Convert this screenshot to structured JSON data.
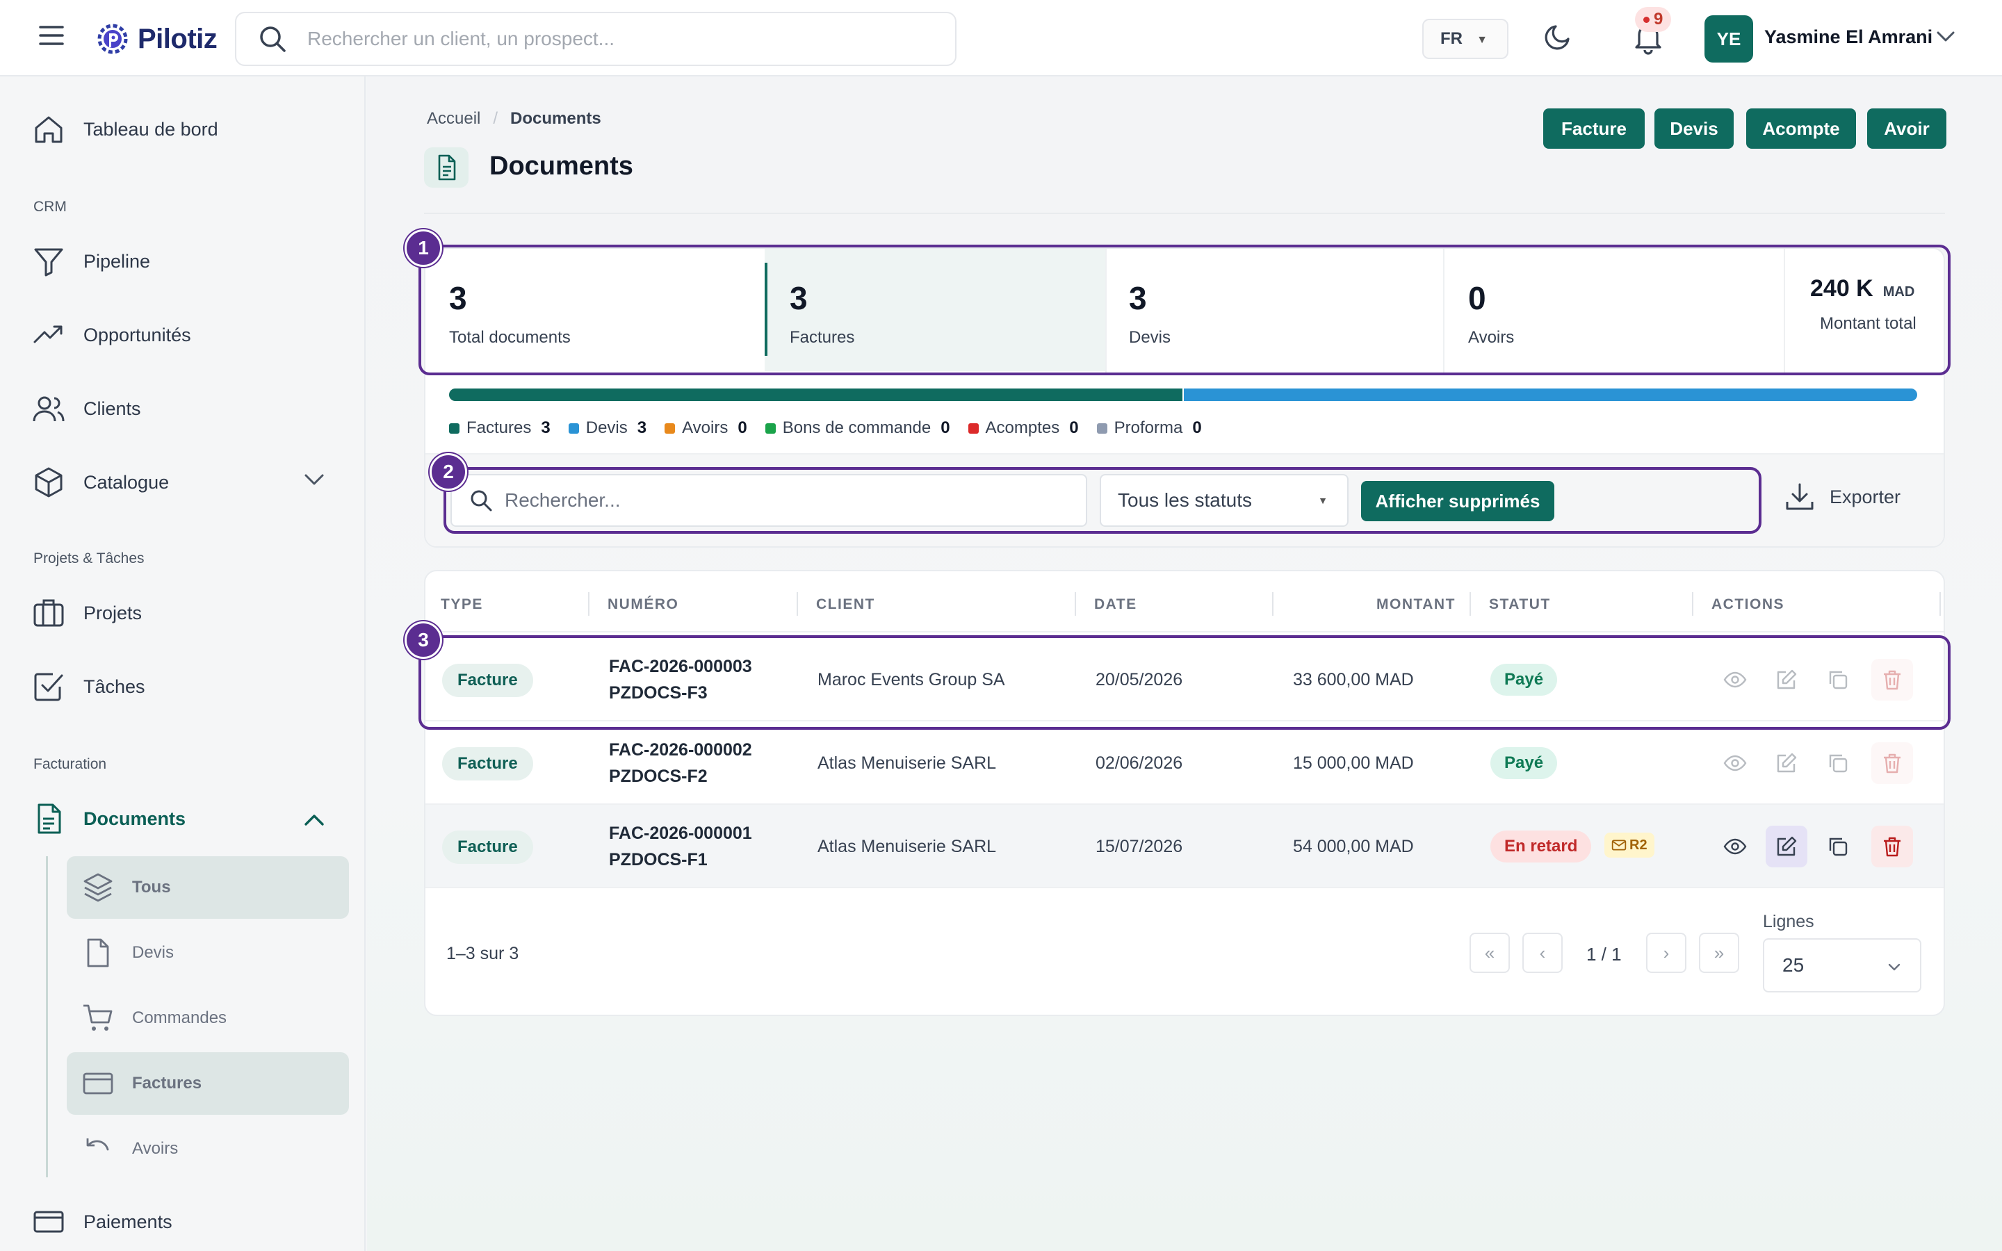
{
  "app": {
    "name": "Pilotiz"
  },
  "topbar": {
    "search_placeholder": "Rechercher un client, un prospect...",
    "language": "FR",
    "notifications_count": "9",
    "user_initials": "YE",
    "user_name": "Yasmine El Amrani"
  },
  "sidebar": {
    "dashboard": "Tableau de bord",
    "section_crm": "CRM",
    "pipeline": "Pipeline",
    "opportunities": "Opportunités",
    "clients": "Clients",
    "catalogue": "Catalogue",
    "section_projects": "Projets & Tâches",
    "projects": "Projets",
    "tasks": "Tâches",
    "section_billing": "Facturation",
    "documents": "Documents",
    "sub": {
      "all": "Tous",
      "quotes": "Devis",
      "orders": "Commandes",
      "invoices": "Factures",
      "credits": "Avoirs"
    },
    "payments": "Paiements"
  },
  "breadcrumb": {
    "home": "Accueil",
    "current": "Documents"
  },
  "page": {
    "title": "Documents"
  },
  "actions": {
    "invoice": "Facture",
    "quote": "Devis",
    "deposit": "Acompte",
    "credit": "Avoir"
  },
  "stats": {
    "total": {
      "value": "3",
      "label": "Total documents"
    },
    "invoices": {
      "value": "3",
      "label": "Factures"
    },
    "quotes": {
      "value": "3",
      "label": "Devis"
    },
    "credits": {
      "value": "0",
      "label": "Avoirs"
    },
    "amount": {
      "value": "240 K",
      "currency": "MAD",
      "label": "Montant total"
    }
  },
  "distribution": {
    "bar": [
      {
        "name": "Factures",
        "share": 0.5,
        "color": "#0f6b5f"
      },
      {
        "name": "Devis",
        "share": 0.5,
        "color": "#2a93d5"
      }
    ],
    "legend": [
      {
        "label": "Factures",
        "count": "3",
        "color": "#0f6b5f"
      },
      {
        "label": "Devis",
        "count": "3",
        "color": "#2a93d5"
      },
      {
        "label": "Avoirs",
        "count": "0",
        "color": "#e8891c"
      },
      {
        "label": "Bons de commande",
        "count": "0",
        "color": "#1aa34a"
      },
      {
        "label": "Acomptes",
        "count": "0",
        "color": "#dc2a2a"
      },
      {
        "label": "Proforma",
        "count": "0",
        "color": "#8f9bb0"
      }
    ]
  },
  "filters": {
    "search_placeholder": "Rechercher...",
    "status_value": "Tous les statuts",
    "show_deleted": "Afficher supprimés",
    "export": "Exporter"
  },
  "annotations": {
    "one": "1",
    "two": "2",
    "three": "3"
  },
  "table": {
    "headers": {
      "type": "TYPE",
      "number": "NUMÉRO",
      "client": "CLIENT",
      "date": "DATE",
      "amount": "MONTANT",
      "status": "STATUT",
      "actions": "ACTIONS"
    },
    "rows": [
      {
        "type": "Facture",
        "number": "FAC-2026-000003",
        "ref": "PZDOCS-F3",
        "client": "Maroc Events Group SA",
        "date": "20/05/2026",
        "amount": "33 600,00 MAD",
        "status": "Payé",
        "status_kind": "paid",
        "reminder": ""
      },
      {
        "type": "Facture",
        "number": "FAC-2026-000002",
        "ref": "PZDOCS-F2",
        "client": "Atlas Menuiserie SARL",
        "date": "02/06/2026",
        "amount": "15 000,00 MAD",
        "status": "Payé",
        "status_kind": "paid",
        "reminder": ""
      },
      {
        "type": "Facture",
        "number": "FAC-2026-000001",
        "ref": "PZDOCS-F1",
        "client": "Atlas Menuiserie SARL",
        "date": "15/07/2026",
        "amount": "54 000,00 MAD",
        "status": "En retard",
        "status_kind": "late",
        "reminder": "R2"
      }
    ]
  },
  "pagination": {
    "summary": "1–3 sur 3",
    "page": "1 / 1",
    "first": "«",
    "prev": "‹",
    "next": "›",
    "last": "»",
    "lines_label": "Lignes",
    "lines_value": "25"
  }
}
